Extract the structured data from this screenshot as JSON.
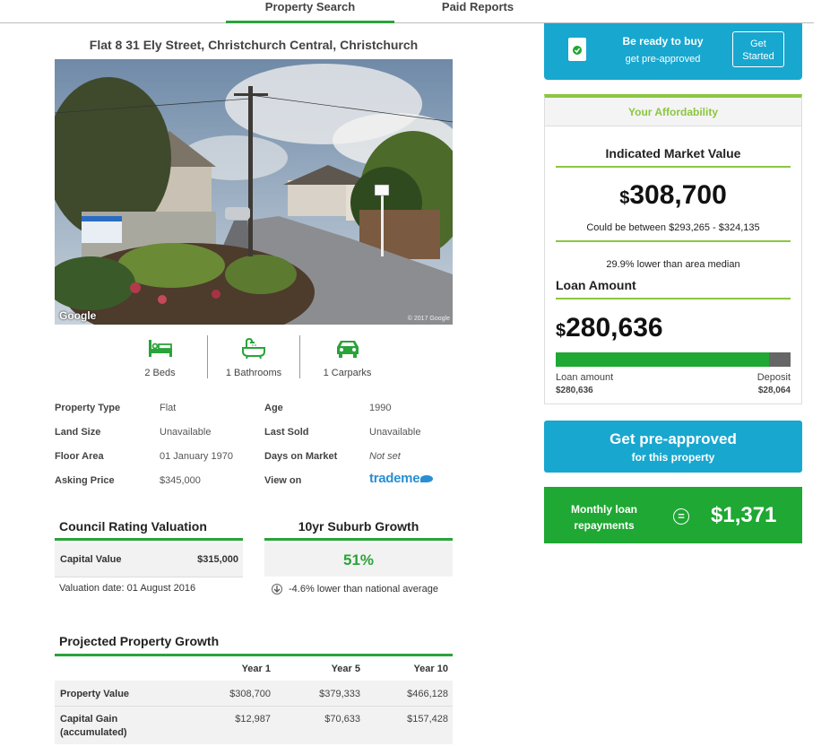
{
  "tabs": [
    {
      "label": "Property Search",
      "active": true
    },
    {
      "label": "Paid Reports",
      "active": false
    }
  ],
  "address": "Flat 8 31 Ely Street, Christchurch Central, Christchurch",
  "photo": {
    "logo": "Google",
    "copyright": "© 2017 Google"
  },
  "features": [
    {
      "icon": "bed-icon",
      "label": "2 Beds"
    },
    {
      "icon": "bathtub-icon",
      "label": "1 Bathrooms"
    },
    {
      "icon": "car-icon",
      "label": "1 Carparks"
    }
  ],
  "details": {
    "property_type": {
      "label": "Property Type",
      "value": "Flat"
    },
    "land_size": {
      "label": "Land Size",
      "value": "Unavailable"
    },
    "floor_area": {
      "label": "Floor Area",
      "value": "01 January 1970"
    },
    "asking_price": {
      "label": "Asking Price",
      "value": "$345,000"
    },
    "age": {
      "label": "Age",
      "value": "1990"
    },
    "last_sold": {
      "label": "Last Sold",
      "value": "Unavailable"
    },
    "days_on_market": {
      "label": "Days on Market",
      "value": "Not set"
    },
    "view_on": {
      "label": "View on",
      "value": "trademe"
    }
  },
  "council": {
    "title": "Council Rating Valuation",
    "capital_label": "Capital Value",
    "capital_value": "$315,000",
    "valuation_date": "Valuation date: 01 August 2016"
  },
  "suburb_growth": {
    "title": "10yr Suburb Growth",
    "value": "51%",
    "note": "-4.6% lower than national average"
  },
  "projected": {
    "title": "Projected Property Growth",
    "columns": [
      "Year 1",
      "Year 5",
      "Year 10"
    ],
    "rows": [
      {
        "label": "Property Value",
        "values": [
          "$308,700",
          "$379,333",
          "$466,128"
        ]
      },
      {
        "label": "Capital Gain",
        "label2": "(accumulated)",
        "values": [
          "$12,987",
          "$70,633",
          "$157,428"
        ]
      }
    ]
  },
  "promo": {
    "title": "Be ready to buy",
    "subtitle": "get pre-approved",
    "button_line1": "Get",
    "button_line2": "Started"
  },
  "affordability": {
    "header": "Your Affordability",
    "imv_title": "Indicated Market Value",
    "currency": "$",
    "imv_value": "308,700",
    "imv_range": "Could be between $293,265 - $324,135",
    "imv_compare": "29.9% lower than area median",
    "loan_title": "Loan Amount",
    "loan_value": "280,636",
    "loan_fraction": 0.909,
    "loan_label": "Loan amount",
    "loan_amount": "$280,636",
    "deposit_label": "Deposit",
    "deposit_amount": "$28,064"
  },
  "cta": {
    "title": "Get pre-approved",
    "subtitle": "for this property"
  },
  "monthly": {
    "line1": "Monthly loan",
    "line2": "repayments",
    "symbol": "=",
    "value": "$1,371"
  },
  "colors": {
    "green": "#2aa33a",
    "blue": "#18a7cf",
    "lime": "#8cc63f"
  }
}
